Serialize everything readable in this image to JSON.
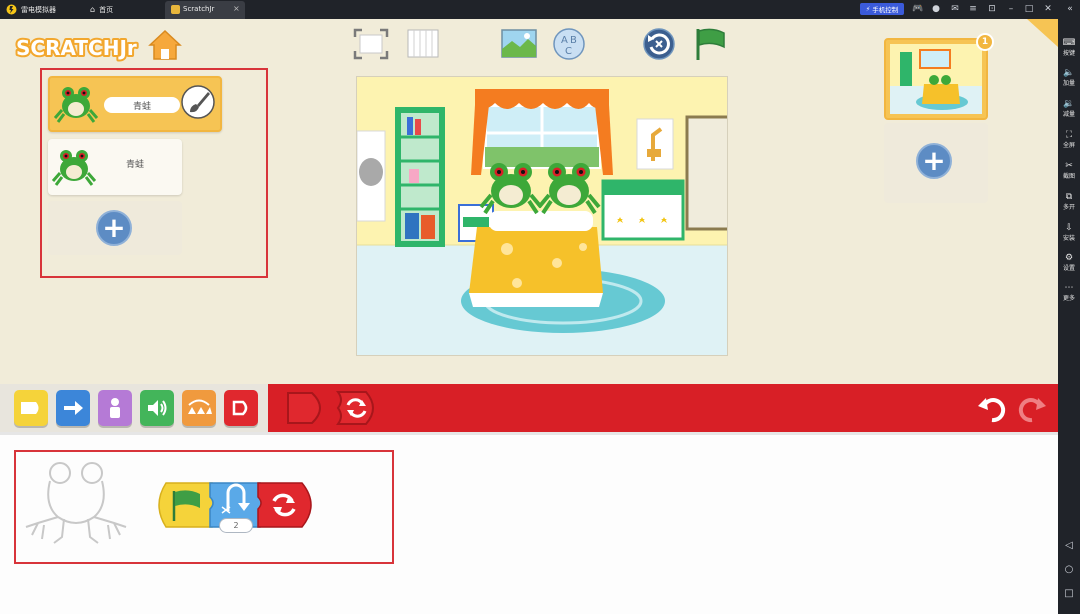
{
  "emulator": {
    "app_name": "雷电模拟器",
    "tabs": [
      {
        "label": "首页"
      },
      {
        "label": "ScratchJr"
      }
    ],
    "phone_control_label": "手机控制",
    "sidebar": [
      {
        "label": "按键"
      },
      {
        "label": "加量"
      },
      {
        "label": "减量"
      },
      {
        "label": "全屏"
      },
      {
        "label": "截图"
      },
      {
        "label": "多开"
      },
      {
        "label": "安装"
      },
      {
        "label": "设置"
      },
      {
        "label": "更多"
      }
    ]
  },
  "app": {
    "logo_text": "SCRATCHJr",
    "sprites": [
      {
        "name": "青蛙",
        "selected": true
      },
      {
        "name": "青蛙",
        "selected": false
      }
    ],
    "page_number": "1",
    "repeat_count": "2",
    "colors": {
      "accent_red": "#d81f26",
      "selected_yellow": "#f6c454",
      "plus_blue": "#5d8cc4"
    }
  }
}
